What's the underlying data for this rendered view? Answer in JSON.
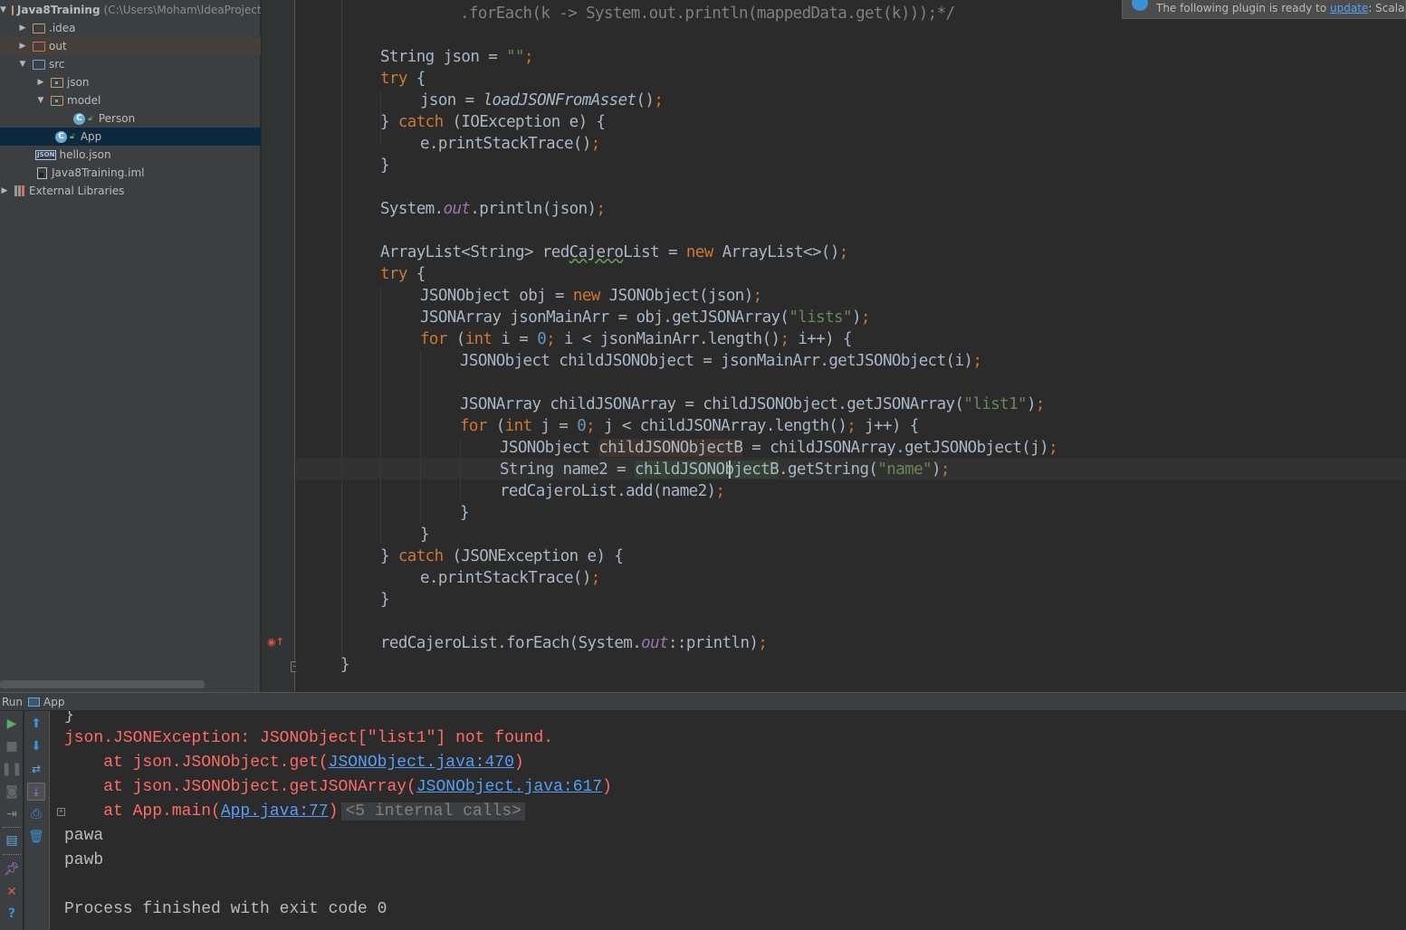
{
  "project_tree": {
    "root": {
      "name": "Java8Training",
      "path": "(C:\\Users\\Moham\\IdeaProjects\\..."
    },
    "items": [
      {
        "label": ".idea",
        "type": "folder",
        "expanded": false
      },
      {
        "label": "out",
        "type": "folder-excluded",
        "expanded": false
      },
      {
        "label": "src",
        "type": "source-folder",
        "expanded": true
      },
      {
        "label": "json",
        "type": "package",
        "expanded": false
      },
      {
        "label": "model",
        "type": "package",
        "expanded": true
      },
      {
        "label": "Person",
        "type": "class"
      },
      {
        "label": "App",
        "type": "class-main",
        "selected": true
      },
      {
        "label": "hello.json",
        "type": "json-file"
      },
      {
        "label": "Java8Training.iml",
        "type": "iml-file"
      },
      {
        "label": "External Libraries",
        "type": "libraries",
        "expanded": false
      }
    ]
  },
  "notification": {
    "text_before": "The following plugin is ready to ",
    "link": "update",
    "text_after": ": Scala"
  },
  "editor": {
    "lines": [
      ".forEach(k -> System.out.println(mappedData.get(k)));*/",
      "String json = \"\";",
      "try {",
      "json = loadJSONFromAsset();",
      "} catch (IOException e) {",
      "e.printStackTrace();",
      "}",
      "System.out.println(json);",
      "ArrayList<String> redCajeroList = new ArrayList<>();",
      "try {",
      "JSONObject obj = new JSONObject(json);",
      "JSONArray jsonMainArr = obj.getJSONArray(\"lists\");",
      "for (int i = 0; i < jsonMainArr.length(); i++) {",
      "JSONObject childJSONObject = jsonMainArr.getJSONObject(i);",
      "JSONArray childJSONArray = childJSONObject.getJSONArray(\"list1\");",
      "for (int j = 0; j < childJSONArray.length(); j++) {",
      "JSONObject childJSONObjectB = childJSONArray.getJSONObject(j);",
      "String name2 = childJSONObjectB.getString(\"name\");",
      "redCajeroList.add(name2);",
      "}",
      "}",
      "} catch (JSONException e) {",
      "e.printStackTrace();",
      "}",
      "redCajeroList.forEach(System.out::println);",
      "}"
    ],
    "tokens": {
      "String": "String",
      "json": "json",
      "eq": " = ",
      "emptystr": "\"\"",
      "semi": ";",
      "try": "try",
      "ob": " {",
      "load": "loadJSONFromAsset",
      "parens": "()",
      "catch": "catch",
      "ioex": " (IOException e) {",
      "cb": "} ",
      "pst": "e.printStackTrace()",
      "close": "}",
      "sys": "System.",
      "out": "out",
      "println_json": ".println(json)",
      "al1": "ArrayList<String> red",
      "cajero": "Cajero",
      "al2": "List = ",
      "new": "new",
      "al3": " ArrayList<>()",
      "jo1": "JSONObject obj = ",
      "jo2": " JSONObject(json)",
      "ja1": "JSONArray jsonMainArr = obj.getJSONArray(",
      "lists": "\"lists\"",
      "rp": ")",
      "for": "for",
      "int": "int",
      "fi1": " i = ",
      "zero": "0",
      "fi2": " i < jsonMainArr.length()",
      "fi3": " i++) {",
      "cjo": "JSONObject childJSONObject = jsonMainArr.getJSONObject(i)",
      "cja1": "JSONArray childJSONArray = childJSONObject.getJSONArray(",
      "list1": "\"list1\"",
      "fj1": " j = ",
      "fj2": " j < childJSONArray.length()",
      "fj3": " j++) {",
      "cjb1": "JSONObject ",
      "cjb_var": "childJSONObjectB",
      "cjb2": " = childJSONArray.getJSONObject(j)",
      "sn1": "String name2 = ",
      "sn2": ".getString(",
      "name": "\"name\"",
      "add": "redCajeroList.add(name2)",
      "jsonex": " (JSONException e) {",
      "fe1": "redCajeroList.forEach(System.",
      "fe2": "::println)",
      "sp": " ",
      "op": " ("
    }
  },
  "run_panel": {
    "label": "Run",
    "config": "App",
    "toolbar_left": [
      "run-icon",
      "stop-icon",
      "pause-icon",
      "dump-threads-icon",
      "exit-icon",
      "layout-icon",
      "pin-icon",
      "close-icon",
      "help-icon"
    ],
    "toolbar_right": [
      "up-arrow-icon",
      "down-arrow-icon",
      "soft-wrap-icon",
      "scroll-to-end-icon",
      "print-icon",
      "trash-icon"
    ],
    "console": {
      "brace": "}",
      "exception": "json.JSONException: JSONObject[\"list1\"] not found.",
      "stack": [
        {
          "prefix": "    at json.JSONObject.get(",
          "link": "JSONObject.java:470",
          "suffix": ")"
        },
        {
          "prefix": "    at json.JSONObject.getJSONArray(",
          "link": "JSONObject.java:617",
          "suffix": ")"
        },
        {
          "prefix": "    at App.main(",
          "link": "App.java:77",
          "suffix": ")",
          "internal": "<5 internal calls>"
        }
      ],
      "output": [
        "pawa",
        "pawb"
      ],
      "exit": "Process finished with exit code 0"
    }
  }
}
